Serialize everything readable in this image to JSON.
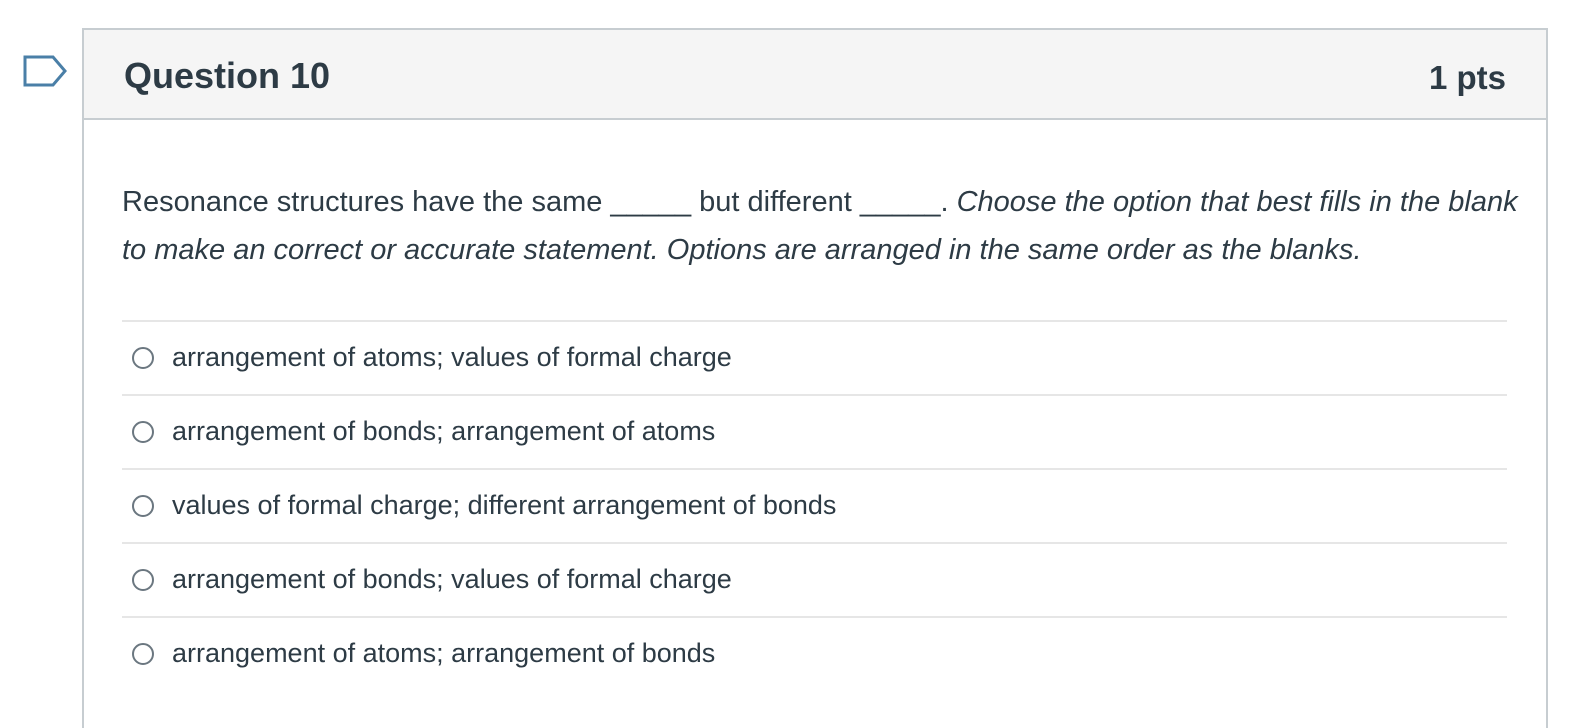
{
  "question": {
    "title": "Question 10",
    "points": "1 pts",
    "text_plain": "Resonance structures have the same _____ but different _____.",
    "text_italic": "Choose the option that best fills in the blank to make an correct or accurate statement. Options are arranged in the same order as the blanks."
  },
  "answers": [
    {
      "label": "arrangement of atoms; values of formal charge",
      "selected": false
    },
    {
      "label": "arrangement of bonds; arrangement of atoms",
      "selected": false
    },
    {
      "label": "values of formal charge; different arrangement of bonds",
      "selected": false
    },
    {
      "label": "arrangement of bonds; values of formal charge",
      "selected": false
    },
    {
      "label": "arrangement of atoms; arrangement of bonds",
      "selected": false
    }
  ],
  "icons": {
    "flag": "bookmark-flag-icon"
  },
  "colors": {
    "text": "#2d3b45",
    "header_bg": "#f5f5f5",
    "border": "#c7cdd1",
    "flag_stroke": "#4a7fa7"
  }
}
